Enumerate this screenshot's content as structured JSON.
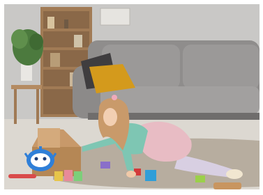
{
  "image": {
    "kind": "photo",
    "subject": "girl-playing-on-rug",
    "palette": {
      "wall": "#c9c8c6",
      "floor": "#dcd8d1",
      "rug": "#b7ad9f",
      "sofa": "#8f8d8c",
      "cushion_yellow": "#d49a1c",
      "cushion_dark": "#3f3d3f",
      "shelf_wood": "#a17b55",
      "shirt_teal": "#7ec6b3",
      "skirt_pink": "#e8bcc4",
      "hair": "#c99a6a",
      "robot_blue": "#2f7fd8"
    }
  }
}
